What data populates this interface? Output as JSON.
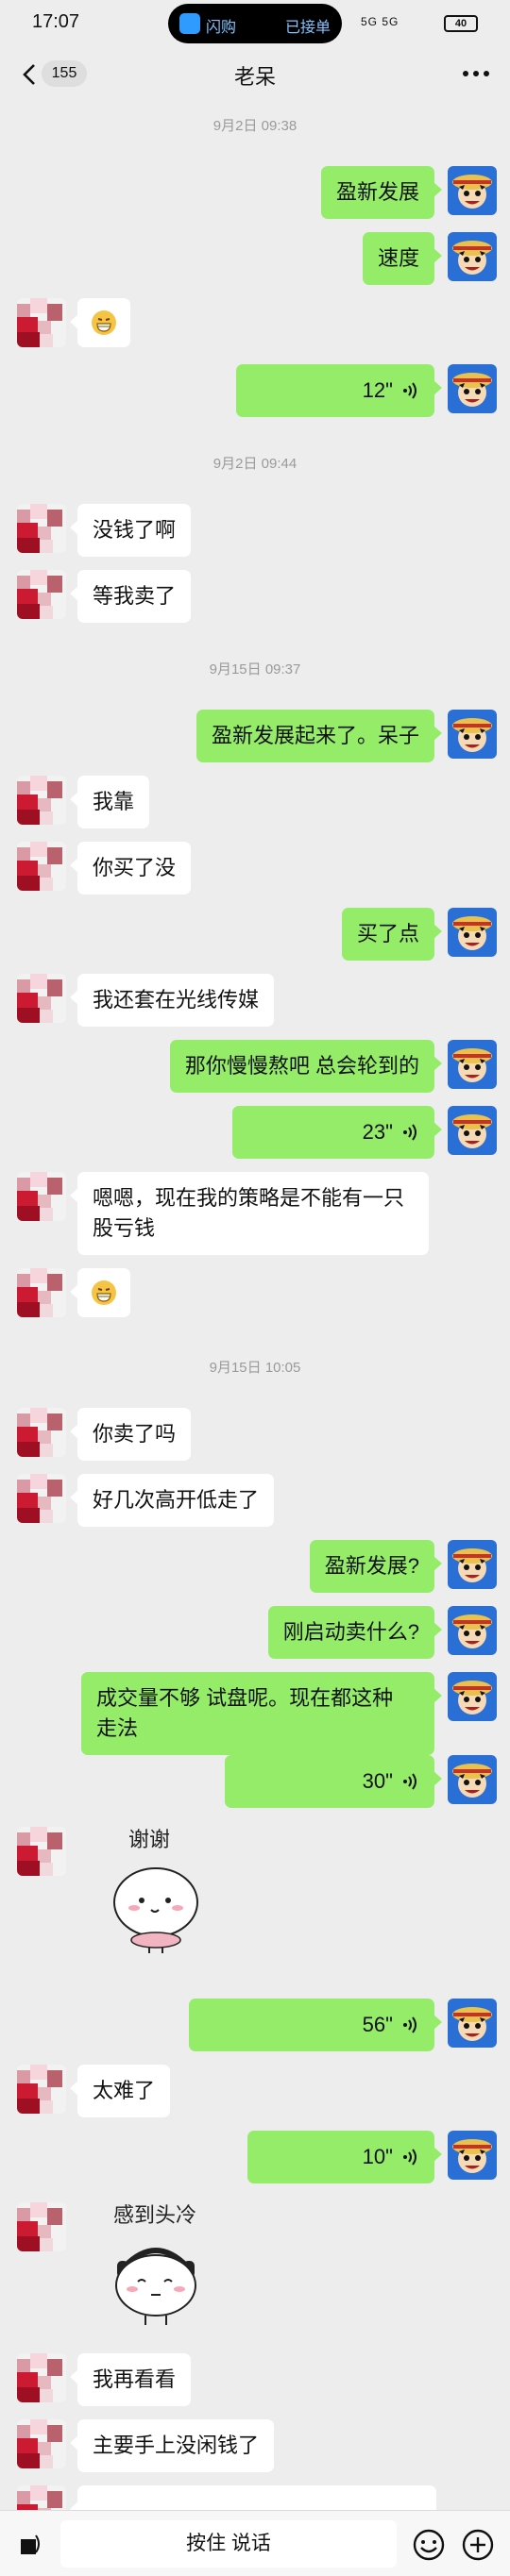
{
  "status_bar": {
    "time": "17:07",
    "app_label": "闪购",
    "accepted_label": "已接单",
    "signal_text": "5G 5G",
    "battery": "40"
  },
  "header": {
    "unread_count": "155",
    "title": "老呆"
  },
  "chat": {
    "timestamps": [
      "9月2日 09:38",
      "9月2日 09:44",
      "9月15日 09:37",
      "9月15日 10:05"
    ],
    "messages": [
      {
        "side": "out",
        "text": "盈新发展"
      },
      {
        "side": "out",
        "text": "速度"
      },
      {
        "side": "in",
        "emoji": "grin"
      },
      {
        "side": "out",
        "voice": "12\""
      },
      {
        "side": "in",
        "text": "没钱了啊"
      },
      {
        "side": "in",
        "text": "等我卖了"
      },
      {
        "side": "out",
        "text": "盈新发展起来了。呆子"
      },
      {
        "side": "in",
        "text": "我靠"
      },
      {
        "side": "in",
        "text": "你买了没"
      },
      {
        "side": "out",
        "text": "买了点"
      },
      {
        "side": "in",
        "text": "我还套在光线传媒"
      },
      {
        "side": "out",
        "text": "那你慢慢熬吧 总会轮到的"
      },
      {
        "side": "out",
        "voice": "23\""
      },
      {
        "side": "in",
        "text_lines": [
          "嗯嗯，现在我的策略是不能有一只",
          "股亏钱"
        ]
      },
      {
        "side": "in",
        "emoji": "grin"
      },
      {
        "side": "in",
        "text": "你卖了吗"
      },
      {
        "side": "in",
        "text": "好几次高开低走了"
      },
      {
        "side": "out",
        "text": "盈新发展?"
      },
      {
        "side": "out",
        "text": "刚启动卖什么?"
      },
      {
        "side": "out",
        "text_lines": [
          "成交量不够 试盘呢。现在都这种",
          "走法"
        ]
      },
      {
        "side": "out",
        "voice": "30\""
      },
      {
        "side": "in",
        "sticker": "谢谢"
      },
      {
        "side": "out",
        "voice": "56\""
      },
      {
        "side": "in",
        "text": "太难了"
      },
      {
        "side": "out",
        "voice": "10\""
      },
      {
        "side": "in",
        "sticker": "感到头冷"
      },
      {
        "side": "in",
        "text": "我再看看"
      },
      {
        "side": "in",
        "text": "主要手上没闲钱了"
      }
    ]
  },
  "input_bar": {
    "hold_to_talk": "按住 说话"
  },
  "colors": {
    "bg": "#ededed",
    "out_bubble": "#95ec69",
    "in_bubble": "#ffffff",
    "timestamp": "#9a9a9a"
  }
}
